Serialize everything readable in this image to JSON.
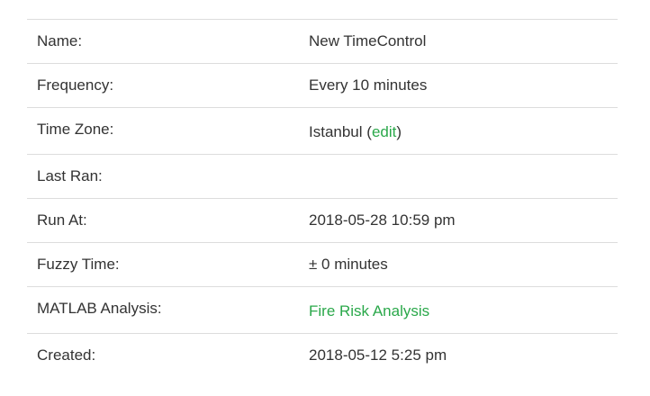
{
  "rows": [
    {
      "label": "Name:",
      "value": "New TimeControl"
    },
    {
      "label": "Frequency:",
      "value": "Every 10 minutes"
    },
    {
      "label": "Time Zone:",
      "value": "Istanbul",
      "link": "edit"
    },
    {
      "label": "Last Ran:",
      "value": ""
    },
    {
      "label": "Run At:",
      "value": "2018-05-28 10:59 pm"
    },
    {
      "label": "Fuzzy Time:",
      "value": "± 0 minutes"
    },
    {
      "label": "MATLAB Analysis:",
      "link": "Fire Risk Analysis"
    },
    {
      "label": "Created:",
      "value": "2018-05-12 5:25 pm"
    }
  ],
  "colors": {
    "link": "#2aa84a",
    "text": "#333333",
    "border": "#dddddd"
  }
}
